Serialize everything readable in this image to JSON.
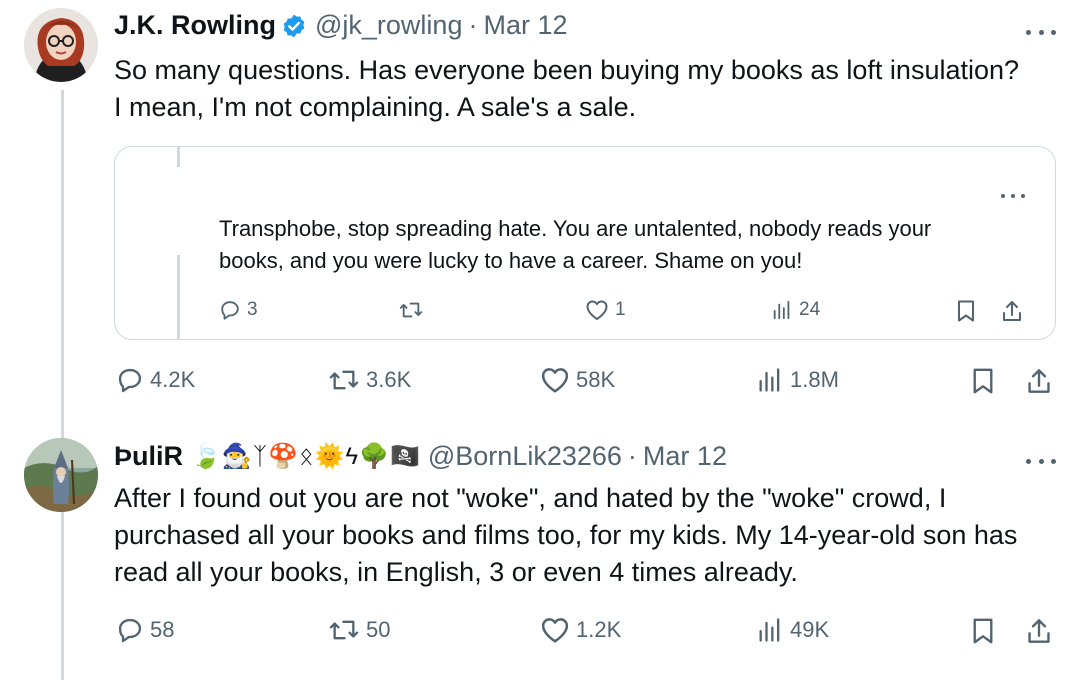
{
  "tweets": [
    {
      "author": {
        "name": "J.K. Rowling",
        "handle": "@jk_rowling",
        "date": "Mar 12",
        "verified": true,
        "avatar": "woman-with-glasses-avatar"
      },
      "text": [
        "So many questions. Has everyone been buying my books as loft insulation?",
        "I mean, I'm not complaining. A sale's a sale."
      ],
      "quoted": {
        "text": [
          "Transphobe, stop spreading hate. You are untalented, nobody reads your",
          "books, and you were lucky to have a career. Shame on you!"
        ],
        "stats": {
          "replies": "3",
          "retweets": "",
          "likes": "1",
          "views": "24"
        }
      },
      "stats": {
        "replies": "4.2K",
        "retweets": "3.6K",
        "likes": "58K",
        "views": "1.8M"
      }
    },
    {
      "author": {
        "name": "ÞuliR",
        "name_emojis": [
          "🍃",
          "🧙‍♂️",
          "ᛉ",
          "🍄",
          "ᛟ",
          "🌞",
          "ϟ",
          "🌳",
          "🏴‍☠️"
        ],
        "handle": "@BornLik23266",
        "date": "Mar 12",
        "verified": false,
        "avatar": "wizard-painting-avatar"
      },
      "text": [
        "After I found out you are not \"woke\", and hated by the \"woke\" crowd, I",
        "purchased all your books and films too, for my kids. My 14-year-old son has",
        "read all your books, in English, 3 or even 4 times already."
      ],
      "stats": {
        "replies": "58",
        "retweets": "50",
        "likes": "1.2K",
        "views": "49K"
      }
    }
  ],
  "separator": "·",
  "colors": {
    "text": "#0f1419",
    "secondary": "#536471",
    "border": "#cfd9de",
    "verified": "#1d9bf0"
  },
  "icons": [
    "reply-icon",
    "retweet-icon",
    "like-icon",
    "views-icon",
    "bookmark-icon",
    "share-icon",
    "more-icon",
    "verified-badge-icon"
  ]
}
